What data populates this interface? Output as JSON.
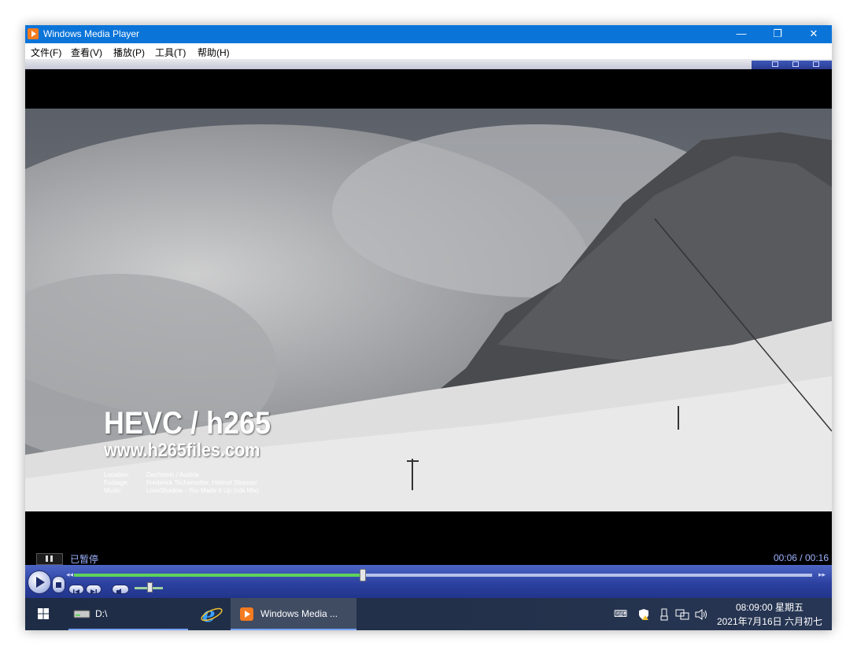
{
  "window": {
    "title": "Windows Media Player",
    "minimize": "—",
    "restore": "❐",
    "close": "✕"
  },
  "menu": [
    {
      "label": "文件(F)"
    },
    {
      "label": "查看(V)"
    },
    {
      "label": "播放(P)"
    },
    {
      "label": "工具(T)"
    },
    {
      "label": "帮助(H)"
    }
  ],
  "video": {
    "headline": "HEVC / h265",
    "url": "www.h265files.com",
    "credits": [
      {
        "key": "Location:",
        "value": "Dachstein / Austria"
      },
      {
        "key": "Footage:",
        "value": "Frederick Tschernutter, Helmut Strasser"
      },
      {
        "key": "Music:",
        "value": "LoveShadow - You Made It Up (cdk Mix)"
      }
    ]
  },
  "status": {
    "state": "已暂停",
    "time": "00:06 / 00:16"
  },
  "playback": {
    "progress_fraction": 0.39,
    "volume_fraction": 0.5,
    "accent": "#5fd35a"
  },
  "taskbar": {
    "drive_label": "D:\\",
    "wmp_label": "Windows Media ...",
    "time": "08:09:00 星期五",
    "date": "2021年7月16日 六月初七",
    "icons": [
      "windows-start-icon",
      "drive-icon",
      "ie-icon",
      "wmp-icon",
      "keyboard-icon",
      "security-shield-icon",
      "usb-icon",
      "network-icon",
      "volume-icon"
    ]
  }
}
